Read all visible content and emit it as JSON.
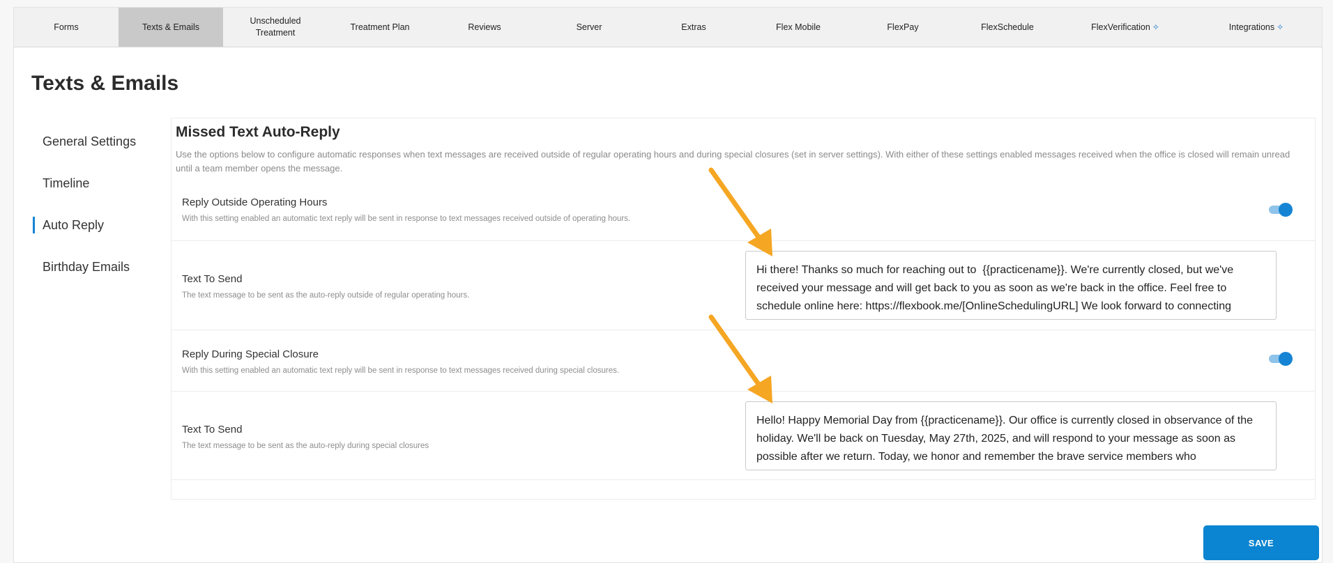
{
  "tabs": [
    {
      "label": "Forms"
    },
    {
      "label": "Texts & Emails"
    },
    {
      "label": "Unscheduled\nTreatment"
    },
    {
      "label": "Treatment Plan"
    },
    {
      "label": "Reviews"
    },
    {
      "label": "Server"
    },
    {
      "label": "Extras"
    },
    {
      "label": "Flex Mobile"
    },
    {
      "label": "FlexPay"
    },
    {
      "label": "FlexSchedule"
    },
    {
      "label": "FlexVerification"
    },
    {
      "label": "Integrations"
    }
  ],
  "page_title": "Texts & Emails",
  "sidenav": {
    "items": [
      {
        "label": "General Settings"
      },
      {
        "label": "Timeline"
      },
      {
        "label": "Auto Reply"
      },
      {
        "label": "Birthday Emails"
      }
    ]
  },
  "section": {
    "title": "Missed Text Auto-Reply",
    "description": "Use the options below to configure automatic responses when text messages are received outside of regular operating hours and during special closures (set in server settings). With either of these settings enabled messages received when the office is closed will remain unread until a team member opens the message."
  },
  "rows": {
    "outside_hours": {
      "label": "Reply Outside Operating Hours",
      "sub": "With this setting enabled an automatic text reply will be sent in response to text messages received outside of operating hours.",
      "enabled": true
    },
    "outside_text": {
      "label": "Text To Send",
      "sub": "The text message to be sent as the auto-reply outside of regular operating hours.",
      "value": "Hi there! Thanks so much for reaching out to  {{practicename}}. We're currently closed, but we've received your message and will get back to you as soon as we're back in the office. Feel free to schedule online here: https://flexbook.me/[OnlineSchedulingURL] We look forward to connecting"
    },
    "special_closure": {
      "label": "Reply During Special Closure",
      "sub": "With this setting enabled an automatic text reply will be sent in response to text messages received during special closures.",
      "enabled": true
    },
    "closure_text": {
      "label": "Text To Send",
      "sub": "The text message to be sent as the auto-reply during special closures",
      "value": "Hello! Happy Memorial Day from {{practicename}}. Our office is currently closed in observance of the holiday. We'll be back on Tuesday, May 27th, 2025, and will respond to your message as soon as possible after we return. Today, we honor and remember the brave service members who"
    }
  },
  "save_label": "SAVE",
  "colors": {
    "accent": "#0b84d1",
    "arrow": "#f5a623"
  },
  "icons": {
    "spark": "sparkle-icon"
  }
}
